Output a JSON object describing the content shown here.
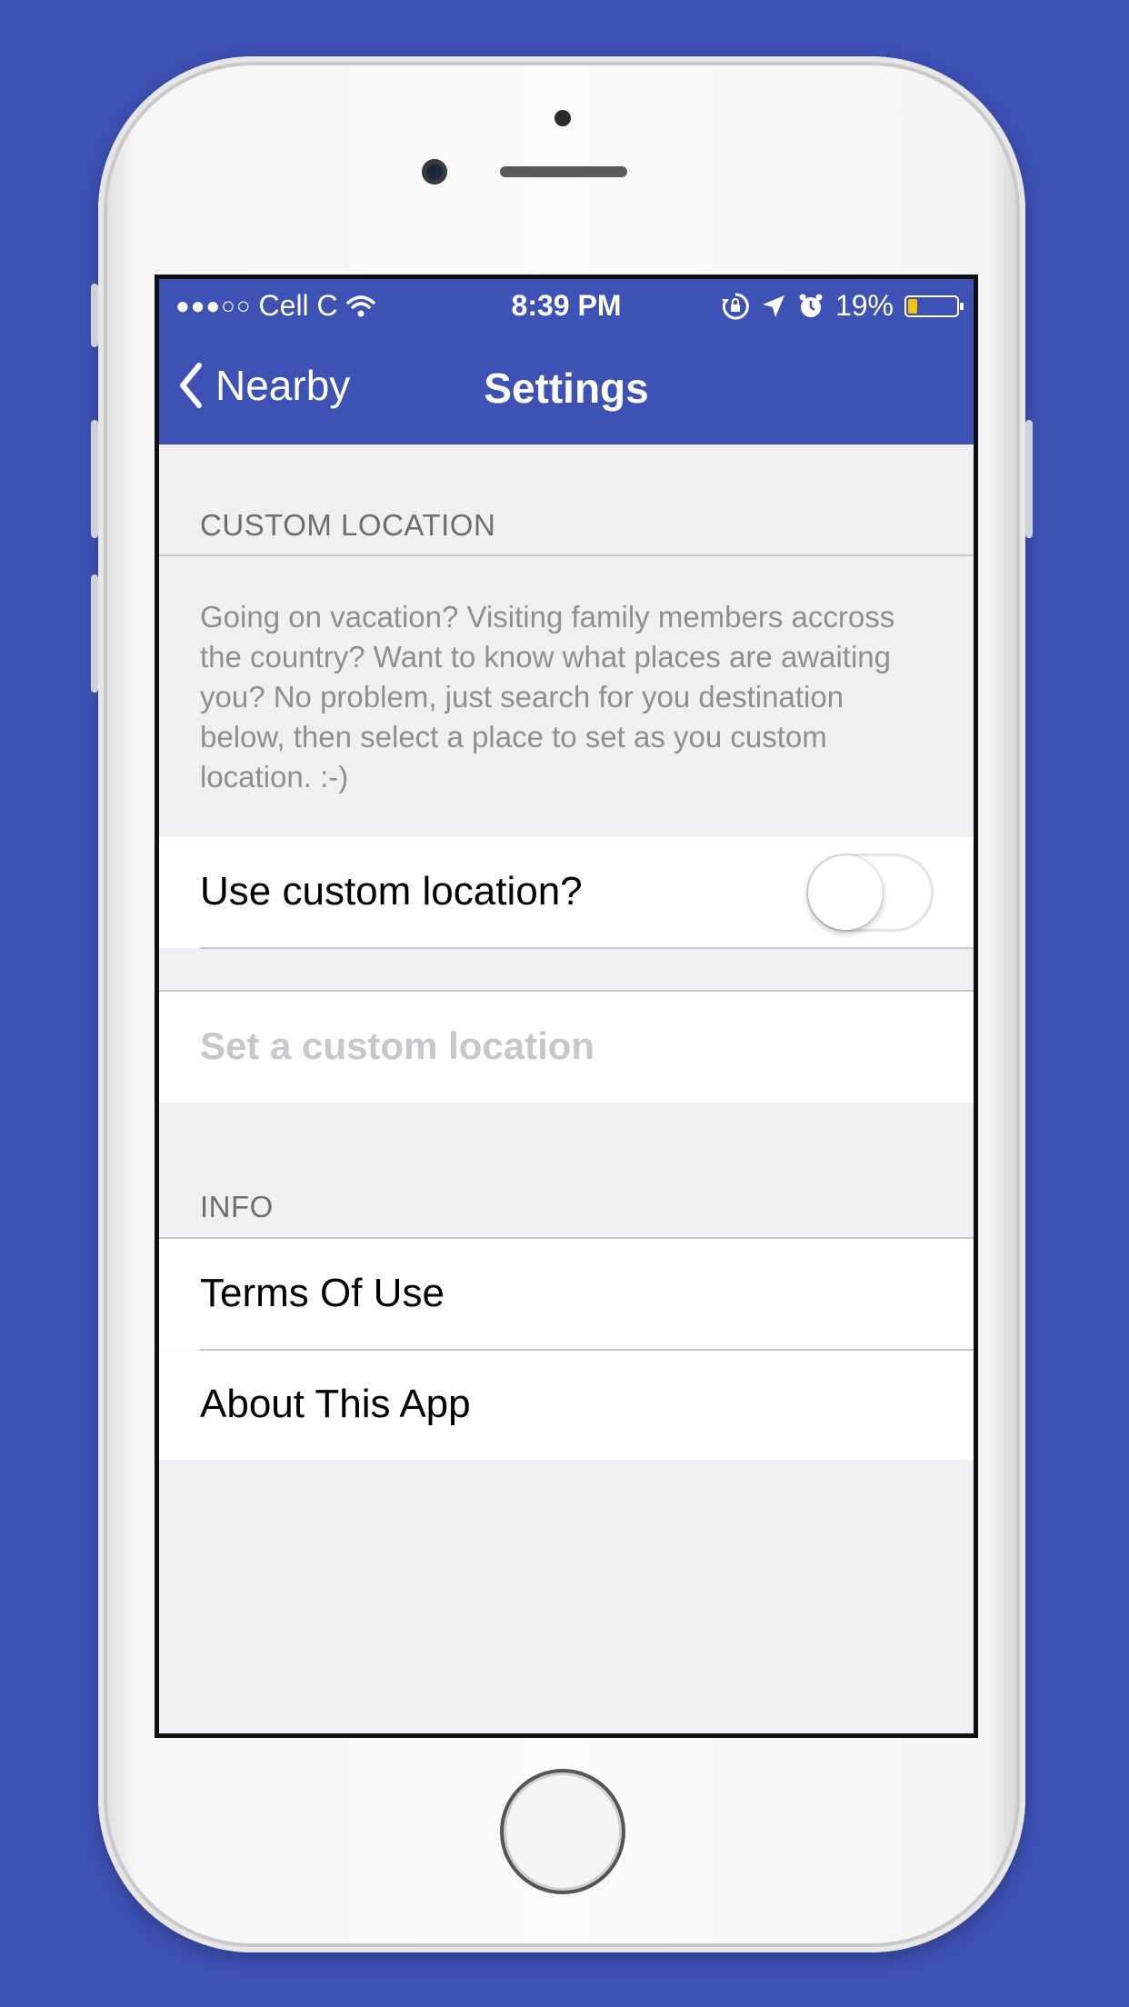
{
  "status_bar": {
    "signal_dots": "●●●○○",
    "carrier": "Cell C",
    "time": "8:39 PM",
    "battery_percent": "19%",
    "battery_level": 0.19,
    "battery_color": "#f5c400"
  },
  "nav": {
    "back_label": "Nearby",
    "title": "Settings",
    "background": "#3e51b5"
  },
  "custom_location": {
    "header": "CUSTOM LOCATION",
    "description": "Going on vacation? Visiting family members accross the country? Want to know what places are awaiting you? No problem, just search for you destination below, then select a place to set as you custom location. :-)",
    "toggle_label": "Use custom location?",
    "toggle_on": false,
    "search_placeholder": "Set a custom location"
  },
  "info": {
    "header": "INFO",
    "items": [
      {
        "label": "Terms Of Use"
      },
      {
        "label": "About This App"
      }
    ]
  },
  "icons": [
    "chevron-left-icon",
    "wifi-icon",
    "orientation-lock-icon",
    "location-arrow-icon",
    "alarm-icon",
    "battery-icon"
  ]
}
